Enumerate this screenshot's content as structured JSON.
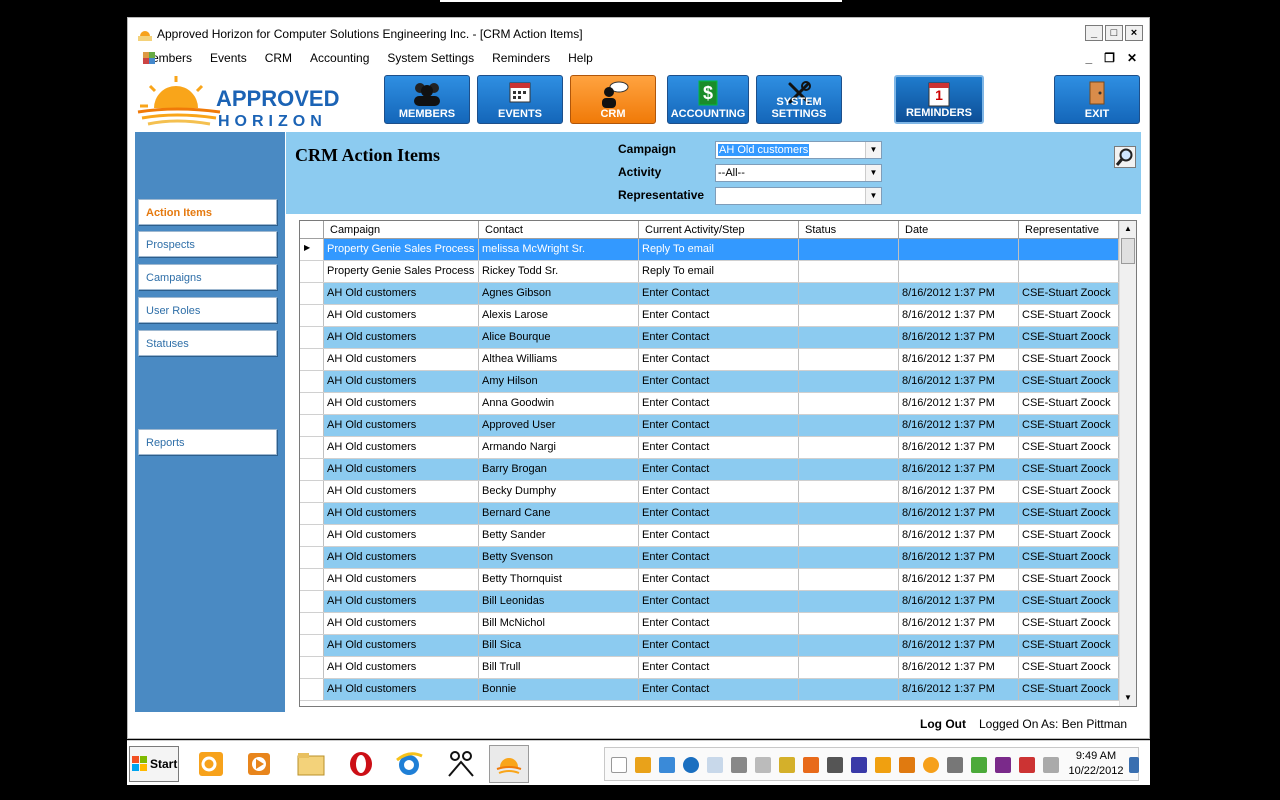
{
  "window": {
    "title": "Approved Horizon for Computer Solutions Engineering Inc. - [CRM Action Items]"
  },
  "menu": [
    "Members",
    "Events",
    "CRM",
    "Accounting",
    "System Settings",
    "Reminders",
    "Help"
  ],
  "logo": {
    "line1": "APPROVED",
    "line2": "HORIZON"
  },
  "toolbar": [
    {
      "label": "MEMBERS",
      "icon": "members-icon"
    },
    {
      "label": "EVENTS",
      "icon": "calendar-icon"
    },
    {
      "label": "CRM",
      "icon": "crm-icon",
      "active": true
    },
    {
      "label": "ACCOUNTING",
      "icon": "dollar-icon"
    },
    {
      "label": "SYSTEM SETTINGS",
      "icon": "tools-icon"
    },
    {
      "label": "REMINDERS",
      "icon": "reminder-calendar-icon",
      "badge": "1"
    },
    {
      "label": "EXIT",
      "icon": "door-icon"
    }
  ],
  "sidebar": [
    {
      "label": "Action Items",
      "selected": true
    },
    {
      "label": "Prospects"
    },
    {
      "label": "Campaigns"
    },
    {
      "label": "User Roles"
    },
    {
      "label": "Statuses"
    },
    {
      "label": "Reports"
    }
  ],
  "header": {
    "title": "CRM Action Items",
    "campaign_label": "Campaign",
    "campaign_value": "AH Old customers",
    "activity_label": "Activity",
    "activity_value": "--All--",
    "representative_label": "Representative",
    "representative_value": ""
  },
  "grid": {
    "columns": [
      "Campaign",
      "Contact",
      "Current Activity/Step",
      "Status",
      "Date",
      "Representative"
    ],
    "rows": [
      [
        "Property Genie Sales Process",
        "melissa  McWright Sr.",
        "Reply To email",
        "",
        "",
        ""
      ],
      [
        "Property Genie Sales Process",
        "Rickey Todd Sr.",
        "Reply To email",
        "",
        "",
        ""
      ],
      [
        "AH Old customers",
        "Agnes Gibson",
        "Enter Contact",
        "",
        "8/16/2012 1:37 PM",
        "CSE-Stuart Zoock"
      ],
      [
        "AH Old customers",
        "Alexis Larose",
        "Enter Contact",
        "",
        "8/16/2012 1:37 PM",
        "CSE-Stuart Zoock"
      ],
      [
        "AH Old customers",
        "Alice Bourque",
        "Enter Contact",
        "",
        "8/16/2012 1:37 PM",
        "CSE-Stuart Zoock"
      ],
      [
        "AH Old customers",
        "Althea Williams",
        "Enter Contact",
        "",
        "8/16/2012 1:37 PM",
        "CSE-Stuart Zoock"
      ],
      [
        "AH Old customers",
        "Amy Hilson",
        "Enter Contact",
        "",
        "8/16/2012 1:37 PM",
        "CSE-Stuart Zoock"
      ],
      [
        "AH Old customers",
        "Anna Goodwin",
        "Enter Contact",
        "",
        "8/16/2012 1:37 PM",
        "CSE-Stuart Zoock"
      ],
      [
        "AH Old customers",
        "Approved User",
        "Enter Contact",
        "",
        "8/16/2012 1:37 PM",
        "CSE-Stuart Zoock"
      ],
      [
        "AH Old customers",
        "Armando Nargi",
        "Enter Contact",
        "",
        "8/16/2012 1:37 PM",
        "CSE-Stuart Zoock"
      ],
      [
        "AH Old customers",
        "Barry Brogan",
        "Enter Contact",
        "",
        "8/16/2012 1:37 PM",
        "CSE-Stuart Zoock"
      ],
      [
        "AH Old customers",
        "Becky Dumphy",
        "Enter Contact",
        "",
        "8/16/2012 1:37 PM",
        "CSE-Stuart Zoock"
      ],
      [
        "AH Old customers",
        "Bernard Cane",
        "Enter Contact",
        "",
        "8/16/2012 1:37 PM",
        "CSE-Stuart Zoock"
      ],
      [
        "AH Old customers",
        "Betty Sander",
        "Enter Contact",
        "",
        "8/16/2012 1:37 PM",
        "CSE-Stuart Zoock"
      ],
      [
        "AH Old customers",
        "Betty Svenson",
        "Enter Contact",
        "",
        "8/16/2012 1:37 PM",
        "CSE-Stuart Zoock"
      ],
      [
        "AH Old customers",
        "Betty Thornquist",
        "Enter Contact",
        "",
        "8/16/2012 1:37 PM",
        "CSE-Stuart Zoock"
      ],
      [
        "AH Old customers",
        "Bill Leonidas",
        "Enter Contact",
        "",
        "8/16/2012 1:37 PM",
        "CSE-Stuart Zoock"
      ],
      [
        "AH Old customers",
        "Bill McNichol",
        "Enter Contact",
        "",
        "8/16/2012 1:37 PM",
        "CSE-Stuart Zoock"
      ],
      [
        "AH Old customers",
        "Bill Sica",
        "Enter Contact",
        "",
        "8/16/2012 1:37 PM",
        "CSE-Stuart Zoock"
      ],
      [
        "AH Old customers",
        "Bill Trull",
        "Enter Contact",
        "",
        "8/16/2012 1:37 PM",
        "CSE-Stuart Zoock"
      ],
      [
        "AH Old customers",
        "Bonnie",
        "Enter Contact",
        "",
        "8/16/2012 1:37 PM",
        "CSE-Stuart Zoock"
      ]
    ]
  },
  "status": {
    "logout": "Log Out",
    "logged_on": "Logged On As: Ben Pittman"
  },
  "taskbar": {
    "start": "Start",
    "time": "9:49 AM",
    "date": "10/22/2012"
  },
  "colors": {
    "accent_blue": "#4a8ac3",
    "header_blue": "#8ccbf0",
    "selection": "#3399ff",
    "active_orange": "#f07a08"
  }
}
